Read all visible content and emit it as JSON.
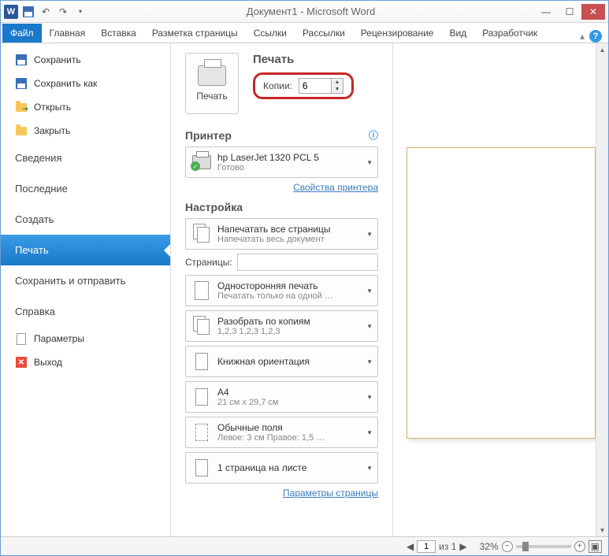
{
  "title": "Документ1 - Microsoft Word",
  "tabs": {
    "file": "Файл",
    "home": "Главная",
    "insert": "Вставка",
    "layout": "Разметка страницы",
    "refs": "Ссылки",
    "mail": "Рассылки",
    "review": "Рецензирование",
    "view": "Вид",
    "dev": "Разработчик"
  },
  "menu": {
    "save": "Сохранить",
    "saveas": "Сохранить как",
    "open": "Открыть",
    "close": "Закрыть",
    "info": "Сведения",
    "recent": "Последние",
    "new": "Создать",
    "print": "Печать",
    "share": "Сохранить и отправить",
    "help": "Справка",
    "options": "Параметры",
    "exit": "Выход"
  },
  "print": {
    "heading": "Печать",
    "button": "Печать",
    "copies_label": "Копии:",
    "copies_value": "6"
  },
  "printer": {
    "heading": "Принтер",
    "name": "hp LaserJet 1320 PCL 5",
    "status": "Готово",
    "props": "Свойства принтера"
  },
  "settings": {
    "heading": "Настройка",
    "scope_title": "Напечатать все страницы",
    "scope_sub": "Напечатать весь документ",
    "pages_label": "Страницы:",
    "duplex_title": "Односторонняя печать",
    "duplex_sub": "Печатать только на одной …",
    "collate_title": "Разобрать по копиям",
    "collate_sub": "1,2,3   1,2,3   1,2,3",
    "orient_title": "Книжная ориентация",
    "paper_title": "A4",
    "paper_sub": "21 см x 29,7 см",
    "margins_title": "Обычные поля",
    "margins_sub": "Левое: 3 см   Правое: 1,5 …",
    "ppp_title": "1 страница на листе",
    "page_setup": "Параметры страницы"
  },
  "status": {
    "page_current": "1",
    "page_of": "из 1",
    "zoom": "32%"
  }
}
